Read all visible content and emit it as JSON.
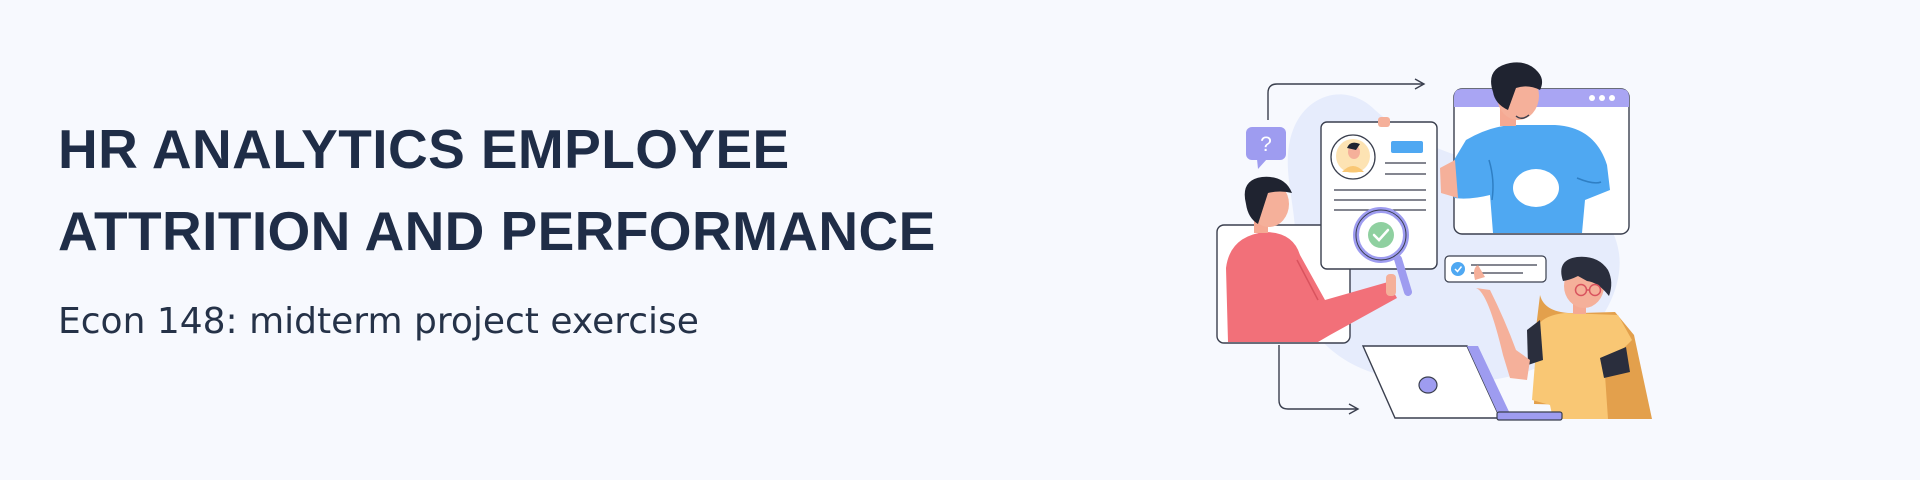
{
  "banner": {
    "title_line1": "HR ANALYTICS EMPLOYEE",
    "title_line2": "ATTRITION AND PERFORMANCE",
    "subtitle": "Econ 148: midterm project exercise"
  },
  "illustration": {
    "question_mark": "?",
    "icons": [
      "question-bubble-icon",
      "magnifier-icon",
      "check-icon",
      "laptop-icon",
      "browser-dots-icon"
    ]
  },
  "colors": {
    "background": "#f7f9fe",
    "title": "#1f2d47",
    "accent_purple": "#9e9cf0",
    "accent_blue": "#4fa8f2",
    "accent_coral": "#f27079",
    "accent_yellow": "#f9c774"
  }
}
